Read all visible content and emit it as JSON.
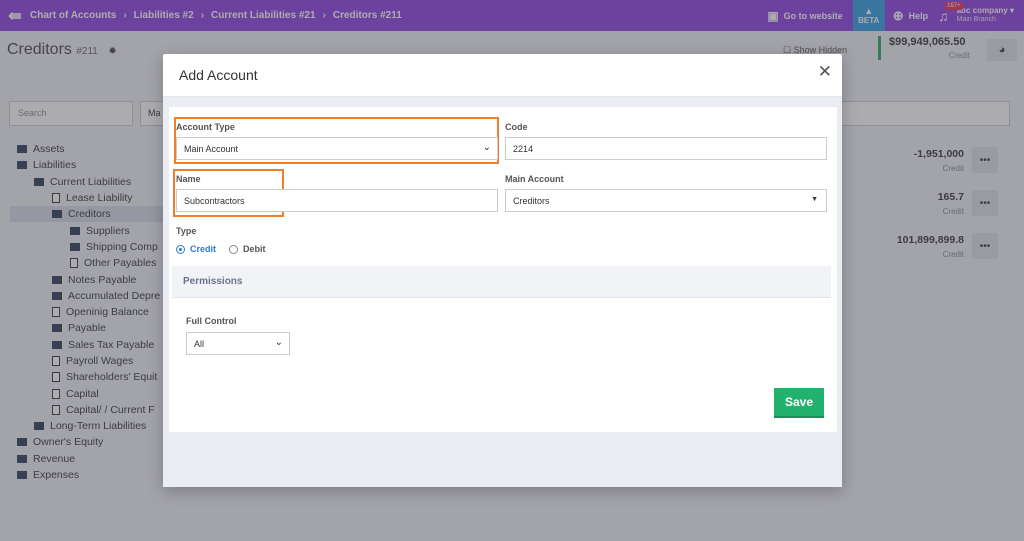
{
  "topbar": {
    "breadcrumbs": [
      "Chart of Accounts",
      "Liabilities #2",
      "Current Liabilities #21",
      "Creditors #211"
    ],
    "go_to_website": "Go to website",
    "beta": "BETA",
    "help": "Help",
    "notifications_badge": "167+",
    "company": "abc company",
    "branch": "Main Branch"
  },
  "page": {
    "title": "Creditors",
    "title_code": "#211",
    "show_hidden": "Show Hidden",
    "balance_value": "$99,949,065.50",
    "balance_label": "Credit",
    "search_placeholder": "Search",
    "filter_value": "Ma"
  },
  "tree": [
    {
      "label": "Assets",
      "icon": "folder-icon"
    },
    {
      "label": "Liabilities",
      "icon": "folder-open-icon"
    },
    {
      "label": "Current Liabilities",
      "icon": "folder-open-icon"
    },
    {
      "label": "Lease Liability",
      "icon": "file-icon"
    },
    {
      "label": "Creditors",
      "icon": "folder-open-icon",
      "selected": true
    },
    {
      "label": "Suppliers",
      "icon": "folder-icon"
    },
    {
      "label": "Shipping Comp",
      "icon": "folder-icon"
    },
    {
      "label": "Other Payables",
      "icon": "file-icon"
    },
    {
      "label": "Notes Payable",
      "icon": "folder-icon"
    },
    {
      "label": "Accumulated Depre",
      "icon": "folder-icon"
    },
    {
      "label": "Openinig Balance",
      "icon": "file-icon"
    },
    {
      "label": "Payable",
      "icon": "folder-icon"
    },
    {
      "label": "Sales Tax Payable",
      "icon": "folder-icon"
    },
    {
      "label": "Payroll Wages",
      "icon": "file-icon"
    },
    {
      "label": "Shareholders' Equit",
      "icon": "file-icon"
    },
    {
      "label": "Capital",
      "icon": "file-icon"
    },
    {
      "label": "Capital/ / Current F",
      "icon": "file-icon"
    },
    {
      "label": "Long-Term Liabilities",
      "icon": "folder-icon"
    },
    {
      "label": "Owner's Equity",
      "icon": "folder-icon"
    },
    {
      "label": "Revenue",
      "icon": "folder-icon"
    },
    {
      "label": "Expenses",
      "icon": "folder-icon"
    }
  ],
  "accounts": [
    {
      "amount": "-1,951,000",
      "side": "Credit",
      "more": "•••"
    },
    {
      "amount": "165.7",
      "side": "Credit",
      "more": "•••"
    },
    {
      "amount": "101,899,899.8",
      "side": "Credit",
      "more": "•••"
    }
  ],
  "modal": {
    "title": "Add Account",
    "account_type_label": "Account Type",
    "account_type_value": "Main Account",
    "code_label": "Code",
    "code_value": "2214",
    "name_label": "Name",
    "name_value": "Subcontractors",
    "main_account_label": "Main Account",
    "main_account_value": "Creditors",
    "type_label": "Type",
    "type_credit": "Credit",
    "type_debit": "Debit",
    "permissions_label": "Permissions",
    "full_control_label": "Full Control",
    "full_control_value": "All",
    "save_label": "Save"
  },
  "colors": {
    "topbar": "#8c3fe0",
    "beta": "#2f9be0",
    "highlight": "#f07f2b",
    "save": "#23b26d",
    "radio_on": "#2a7ae0"
  }
}
